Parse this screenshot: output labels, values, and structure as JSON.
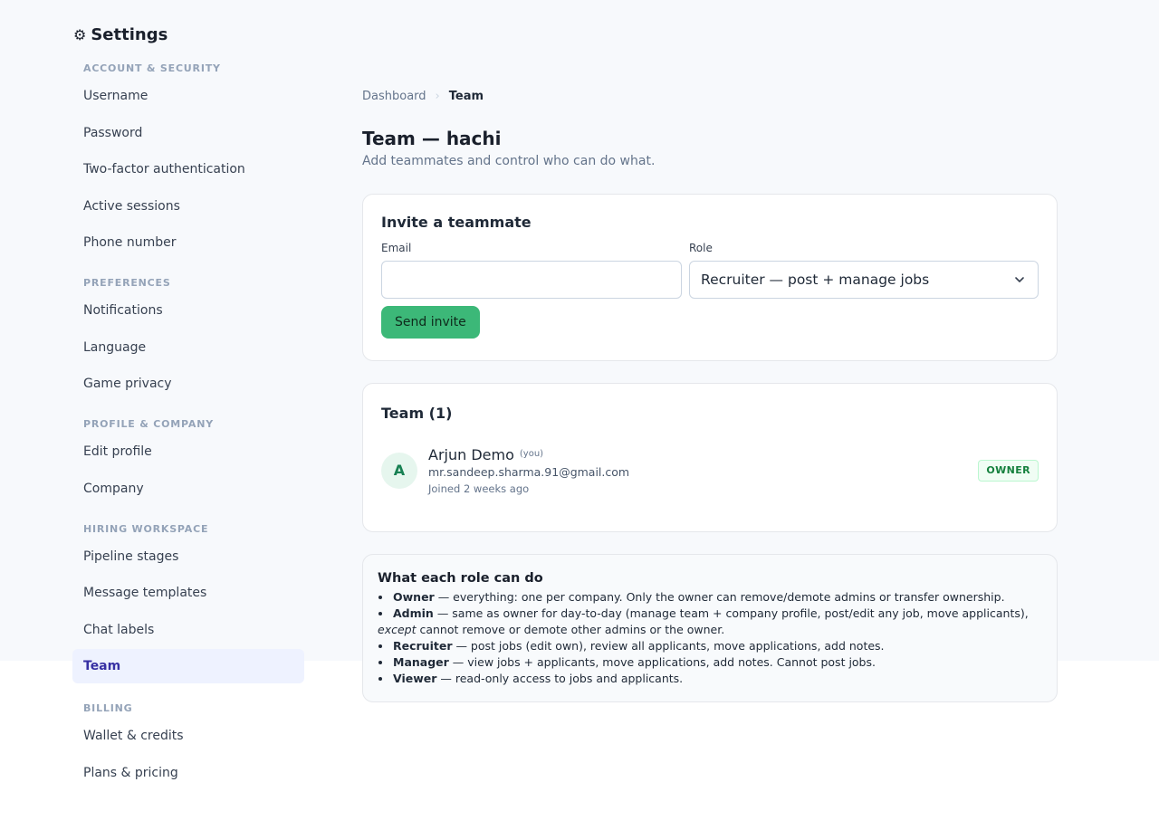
{
  "app": {
    "title": "Settings",
    "gear_icon": "⚙"
  },
  "sidebar": {
    "sections": [
      {
        "label": "ACCOUNT & SECURITY",
        "items": [
          "Username",
          "Password",
          "Two-factor authentication",
          "Active sessions",
          "Phone number"
        ]
      },
      {
        "label": "PREFERENCES",
        "items": [
          "Notifications",
          "Language",
          "Game privacy"
        ]
      },
      {
        "label": "PROFILE & COMPANY",
        "items": [
          "Edit profile",
          "Company"
        ]
      },
      {
        "label": "HIRING WORKSPACE",
        "items": [
          "Pipeline stages",
          "Message templates",
          "Chat labels",
          "Team"
        ]
      },
      {
        "label": "BILLING",
        "items": [
          "Wallet & credits",
          "Plans & pricing"
        ]
      }
    ],
    "active_item": "Team"
  },
  "breadcrumb": {
    "parent": "Dashboard",
    "current": "Team"
  },
  "page": {
    "title": "Team — hachi",
    "subtitle": "Add teammates and control who can do what."
  },
  "invite": {
    "title": "Invite a teammate",
    "email_label": "Email",
    "email_value": "",
    "role_label": "Role",
    "role_selected": "Recruiter — post + manage jobs",
    "send_label": "Send invite"
  },
  "team": {
    "title": "Team (1)",
    "members": [
      {
        "initial": "A",
        "name": "Arjun Demo",
        "you_tag": "(you)",
        "email": "mr.sandeep.sharma.91@gmail.com",
        "joined": "Joined 2 weeks ago",
        "role_badge": "OWNER"
      }
    ]
  },
  "roles_info": {
    "title": "What each role can do",
    "owner": {
      "name": "Owner",
      "text": " — everything: one per company. Only the owner can remove/demote admins or transfer ownership."
    },
    "admin": {
      "name": "Admin",
      "text": " — same as owner for day-to-day (manage team + company profile, post/edit any job, move applicants),",
      "except_word": "except",
      "except_text": " cannot remove or demote other admins or the owner."
    },
    "recruiter": {
      "name": "Recruiter",
      "text": " — post jobs (edit own), review all applicants, move applications, add notes."
    },
    "manager": {
      "name": "Manager",
      "text": " — view jobs + applicants, move applications, add notes. Cannot post jobs."
    },
    "viewer": {
      "name": "Viewer",
      "text": " — read-only access to jobs and applicants."
    }
  },
  "colors": {
    "accent_active": "#3730a3",
    "active_bg": "#eef2ff",
    "send_button": "#3cb878",
    "owner_badge": "#15803d"
  }
}
